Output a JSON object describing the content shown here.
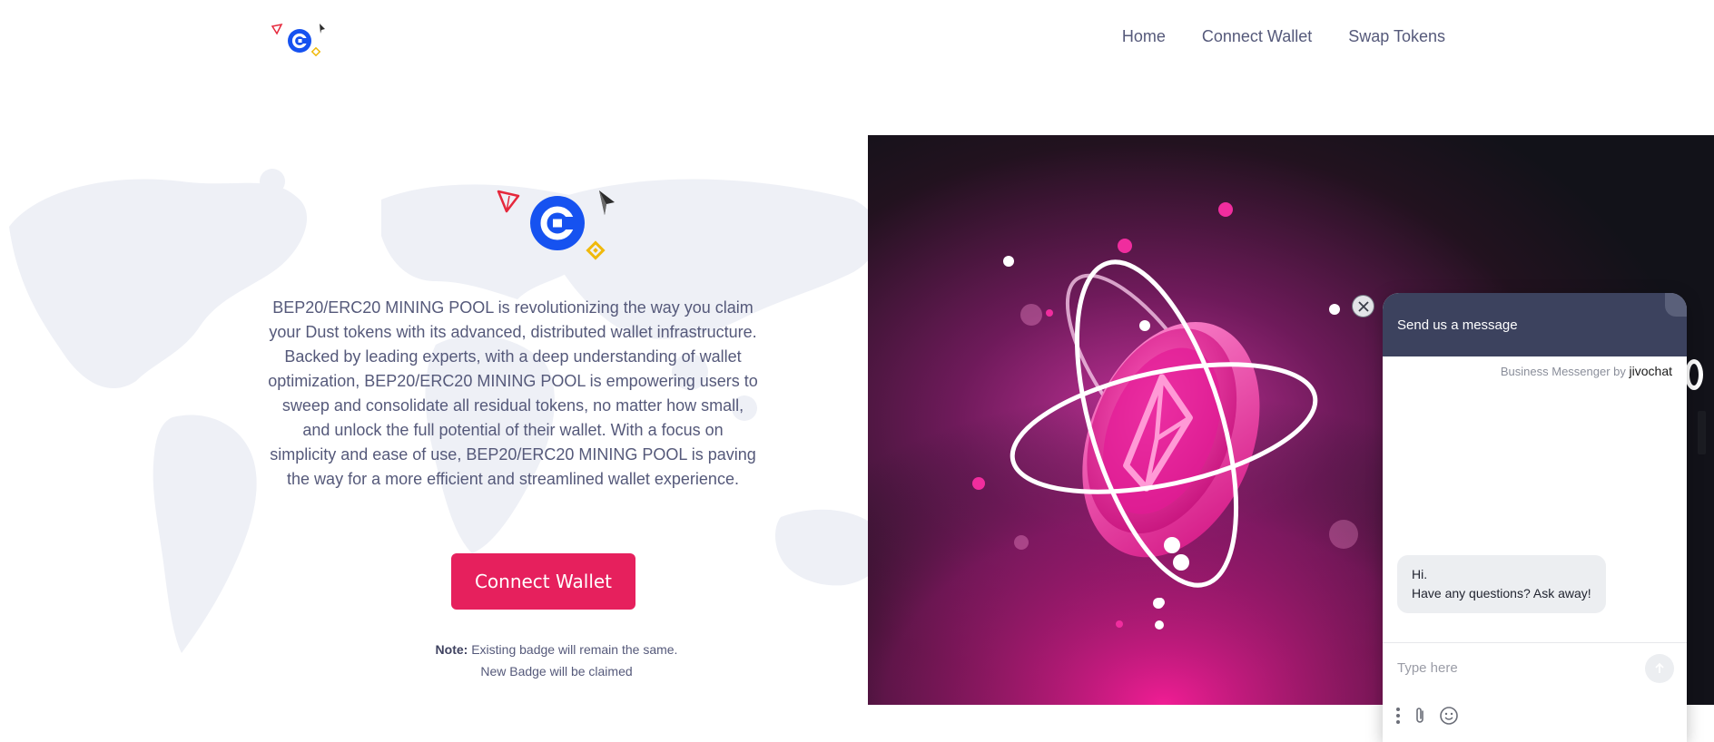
{
  "nav": {
    "home": "Home",
    "connect_wallet": "Connect Wallet",
    "swap_tokens": "Swap Tokens"
  },
  "main": {
    "description": "BEP20/ERC20 MINING POOL is revolutionizing the way you claim your Dust tokens with its advanced, distributed wallet infrastructure. Backed by leading experts, with a deep understanding of wallet optimization, BEP20/ERC20 MINING POOL is empowering users to sweep and consolidate all residual tokens, no matter how small, and unlock the full potential of their wallet. With a focus on simplicity and ease of use, BEP20/ERC20 MINING POOL is paving the way for a more efficient and streamlined wallet experience.",
    "connect_button": "Connect Wallet",
    "note_label": "Note:",
    "note_line1": "Existing badge will remain the same.",
    "note_line2": "New Badge will be claimed"
  },
  "chat": {
    "title": "Send us a message",
    "brand_prefix": "Business Messenger by",
    "brand_name": "jivochat",
    "greeting_line1": "Hi.",
    "greeting_line2": "Have any questions? Ask away!",
    "input_placeholder": "Type here"
  },
  "colors": {
    "accent": "#e6205d",
    "chat_header": "#3c425e",
    "text": "#55597a",
    "coinbase_blue": "#1652f0",
    "tron_red": "#e5283c",
    "bnb_yellow": "#f0b90b"
  },
  "icons": [
    "coinbase-logo-icon",
    "tron-icon",
    "ethereum-icon",
    "bnb-icon",
    "close-icon",
    "send-arrow-icon",
    "menu-dots-icon",
    "paperclip-icon",
    "smiley-icon"
  ]
}
